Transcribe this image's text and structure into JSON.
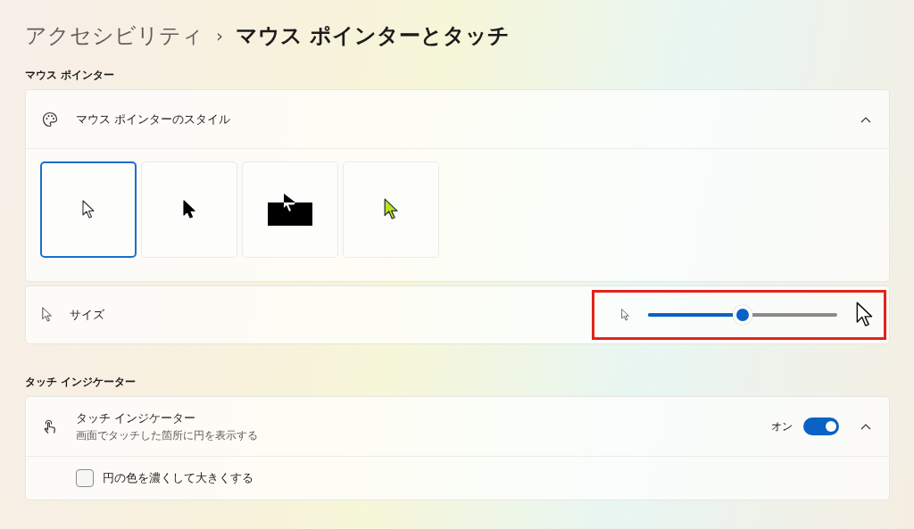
{
  "breadcrumb": {
    "parent": "アクセシビリティ",
    "separator": "›",
    "current": "マウス ポインターとタッチ"
  },
  "sections": [
    {
      "title": "マウス ポインター",
      "kind": "pointer"
    },
    {
      "title": "タッチ インジケーター",
      "kind": "touch"
    }
  ],
  "pointer_style": {
    "label": "マウス ポインターのスタイル",
    "expanded": true,
    "styles": [
      {
        "kind": "white",
        "selected": true
      },
      {
        "kind": "black",
        "selected": false
      },
      {
        "kind": "inverted",
        "selected": false
      },
      {
        "kind": "custom",
        "color": "#b5e61d",
        "selected": false
      }
    ]
  },
  "size": {
    "label": "サイズ",
    "level": 0.5,
    "highlighted": true
  },
  "touch_indicator": {
    "label": "タッチ インジケーター",
    "description": "画面でタッチした箇所に円を表示する",
    "state_label": "オン",
    "on": true,
    "expanded": true,
    "option": {
      "label": "円の色を濃くして大きくする",
      "checked": false
    }
  }
}
